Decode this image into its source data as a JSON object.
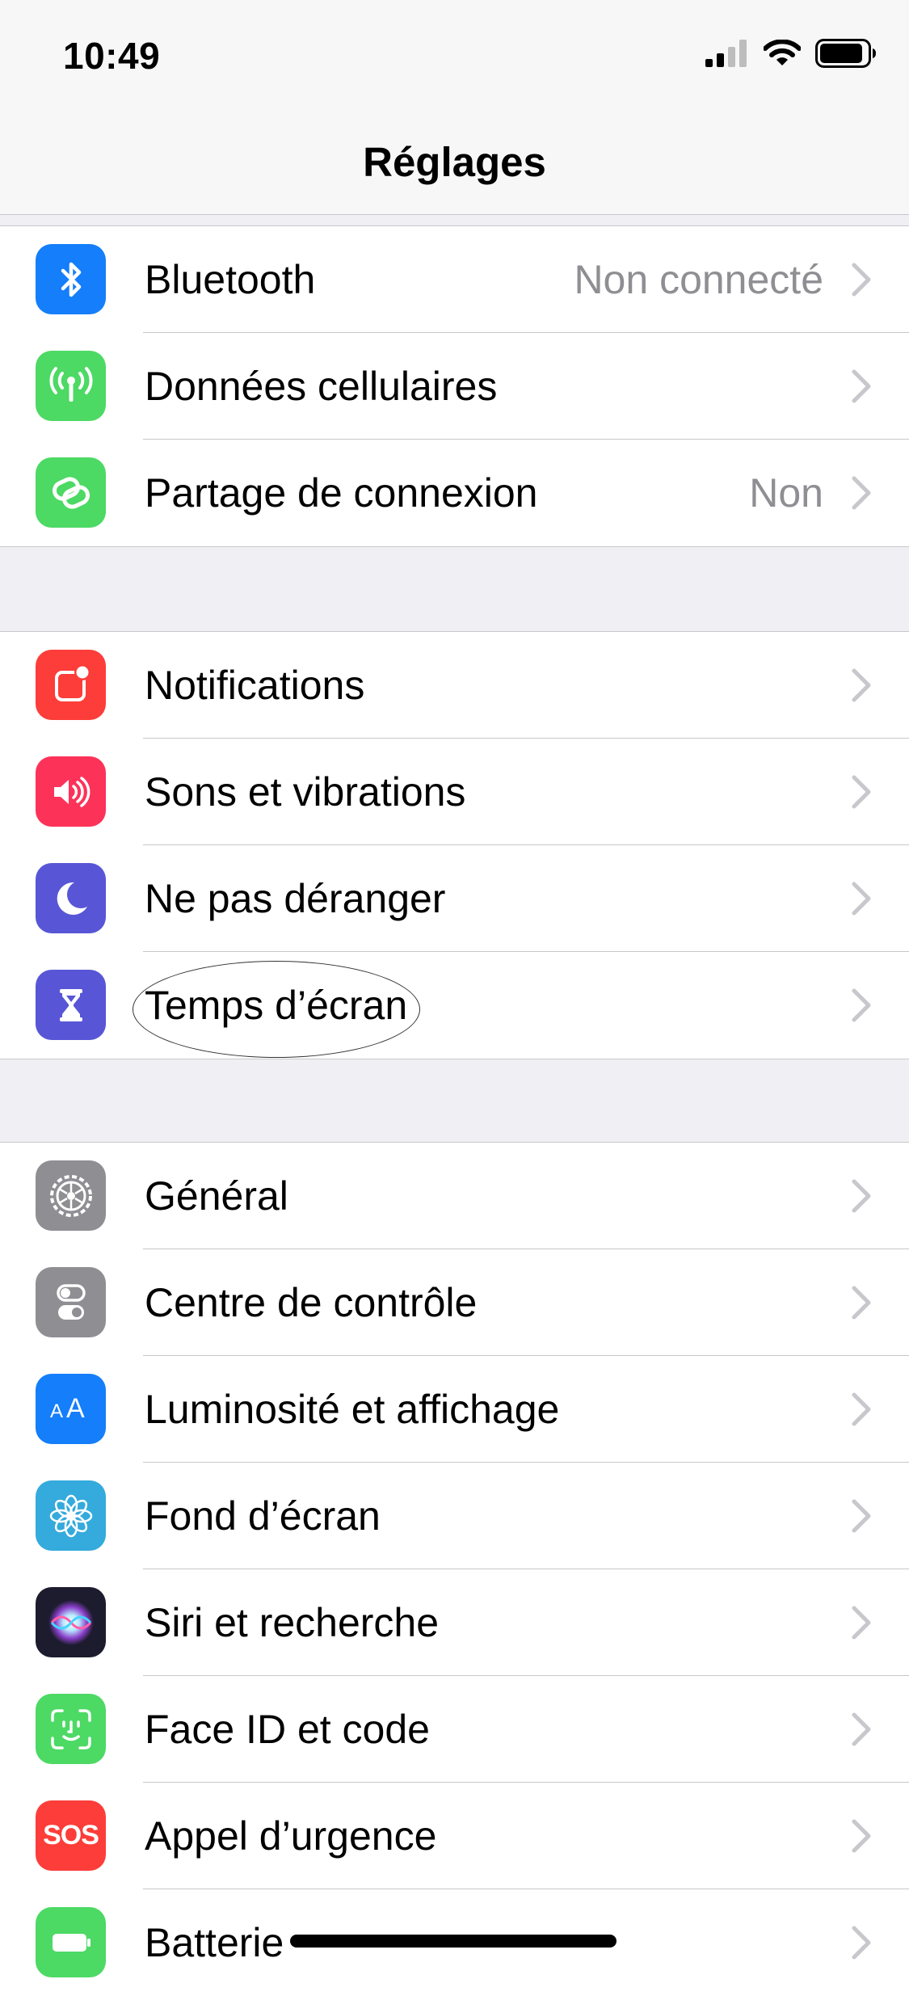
{
  "status_bar": {
    "time": "10:49"
  },
  "nav": {
    "title": "Réglages"
  },
  "groups": [
    {
      "rows": [
        {
          "label": "Bluetooth",
          "value": "Non connecté",
          "icon": "bluetooth-icon",
          "color": "#147efb"
        },
        {
          "label": "Données cellulaires",
          "value": "",
          "icon": "cellular-antenna-icon",
          "color": "#4cd964"
        },
        {
          "label": "Partage de connexion",
          "value": "Non",
          "icon": "hotspot-chain-icon",
          "color": "#4cd964"
        }
      ]
    },
    {
      "rows": [
        {
          "label": "Notifications",
          "icon": "notifications-icon",
          "color": "#fc3d39"
        },
        {
          "label": "Sons et vibrations",
          "icon": "speaker-icon",
          "color": "#fd3259"
        },
        {
          "label": "Ne pas déranger",
          "icon": "moon-icon",
          "color": "#5856d6"
        },
        {
          "label": "Temps d’écran",
          "icon": "hourglass-icon",
          "color": "#5856d6"
        }
      ]
    },
    {
      "rows": [
        {
          "label": "Général",
          "icon": "gear-icon",
          "color": "#8e8e93"
        },
        {
          "label": "Centre de contrôle",
          "icon": "toggles-icon",
          "color": "#8e8e93"
        },
        {
          "label": "Luminosité et affichage",
          "icon": "text-size-icon",
          "color": "#147efb"
        },
        {
          "label": "Fond d’écran",
          "icon": "flower-icon",
          "color": "#35aadc"
        },
        {
          "label": "Siri et recherche",
          "icon": "siri-icon",
          "color": "#1c1c2e"
        },
        {
          "label": "Face ID et code",
          "icon": "face-id-icon",
          "color": "#4cd964"
        },
        {
          "label": "Appel d’urgence",
          "icon": "sos-icon",
          "color": "#fc3d39",
          "icon_text": "SOS"
        },
        {
          "label": "Batterie",
          "icon": "battery-icon",
          "color": "#4cd964"
        }
      ]
    }
  ]
}
